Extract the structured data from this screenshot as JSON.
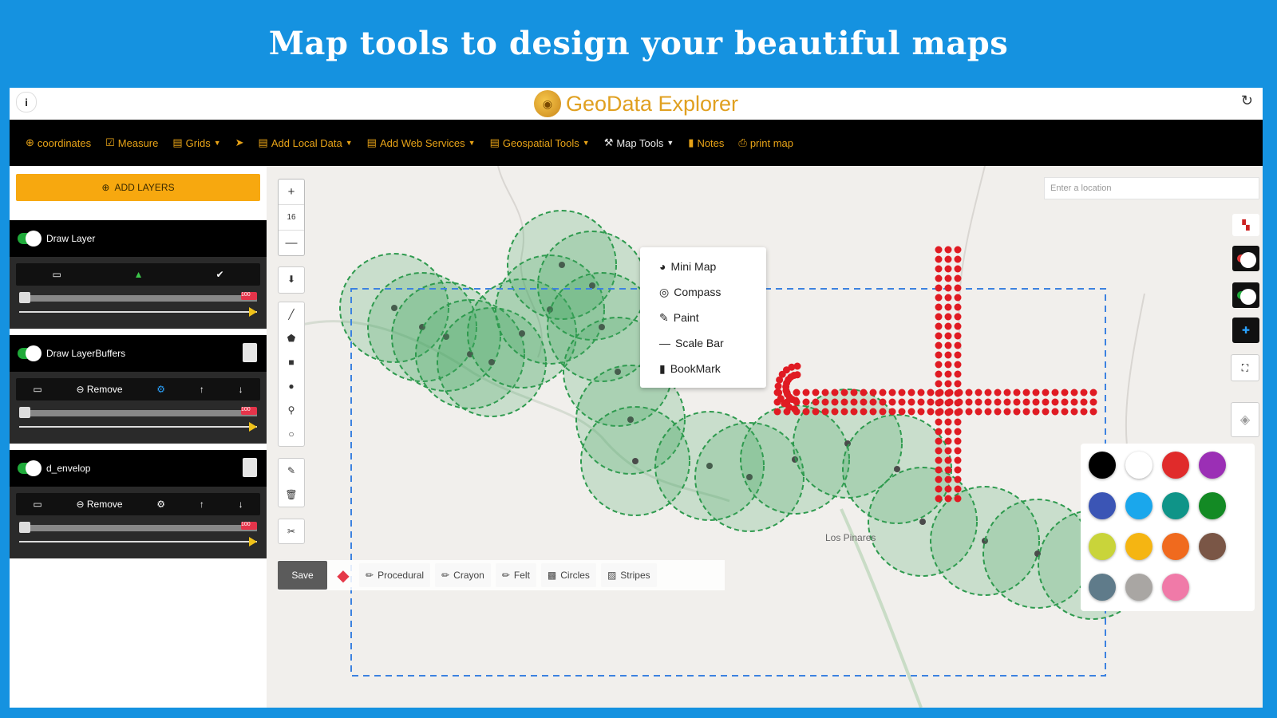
{
  "banner": {
    "headline": "Map tools to design your beautiful maps"
  },
  "app": {
    "title": "GeoData Explorer",
    "info_icon": "info-icon",
    "refresh_icon": "refresh-icon"
  },
  "nav": {
    "items": [
      {
        "label": "coordinates",
        "icon": "target-icon",
        "dropdown": false
      },
      {
        "label": "Measure",
        "icon": "check-icon",
        "dropdown": false
      },
      {
        "label": "Grids",
        "icon": "database-icon",
        "dropdown": true
      },
      {
        "label": "",
        "icon": "location-arrow-icon",
        "dropdown": false
      },
      {
        "label": "Add Local Data",
        "icon": "database-icon",
        "dropdown": true
      },
      {
        "label": "Add Web Services",
        "icon": "database-icon",
        "dropdown": true
      },
      {
        "label": "Geospatial Tools",
        "icon": "database-icon",
        "dropdown": true
      },
      {
        "label": "Map Tools",
        "icon": "tools-icon",
        "dropdown": true,
        "active": true
      },
      {
        "label": "Notes",
        "icon": "note-icon",
        "dropdown": false
      },
      {
        "label": "print map",
        "icon": "print-icon",
        "dropdown": false
      }
    ]
  },
  "map_tools_menu": {
    "items": [
      {
        "label": "Mini Map",
        "icon": "globe-icon"
      },
      {
        "label": "Compass",
        "icon": "compass-icon"
      },
      {
        "label": "Paint",
        "icon": "brush-icon"
      },
      {
        "label": "Scale Bar",
        "icon": "minus-icon"
      },
      {
        "label": "BookMark",
        "icon": "bookmark-icon"
      }
    ]
  },
  "sidebar": {
    "add_layers_label": "ADD LAYERS",
    "layers": [
      {
        "name": "Draw Layer",
        "tools": [
          "desktop-icon",
          "triangle-icon",
          "check-circle-icon"
        ],
        "remove_label": ""
      },
      {
        "name": "Draw LayerBuffers",
        "tools": [
          "desktop-icon",
          "remove-icon",
          "settings-icon",
          "arrow-up-icon",
          "arrow-down-icon"
        ],
        "remove_label": "Remove"
      },
      {
        "name": "d_envelop",
        "tools": [
          "desktop-icon",
          "remove-icon",
          "settings-icon",
          "arrow-up-icon",
          "arrow-down-icon"
        ],
        "remove_label": "Remove"
      }
    ],
    "opacity_max_label": "100"
  },
  "map": {
    "zoom_level": "16",
    "search_placeholder": "Enter a location",
    "place_labels": [
      "Los Pinares"
    ],
    "paint": {
      "save_label": "Save",
      "brushes": [
        "Procedural",
        "Crayon",
        "Felt",
        "Circles",
        "Stripes"
      ]
    },
    "palette_colors": [
      "#000000",
      "#ffffff",
      "#e02b2b",
      "#9b2fb5",
      "#3b55b5",
      "#1aa7ec",
      "#0f9488",
      "#138a24",
      "#c9d43a",
      "#f5b512",
      "#f06a1e",
      "#7a5646",
      "#5f7b8a",
      "#a9a6a3",
      "#f07aa8"
    ],
    "drawn_line_color": "#e01b23",
    "buffer_color": "#3ba55d"
  }
}
